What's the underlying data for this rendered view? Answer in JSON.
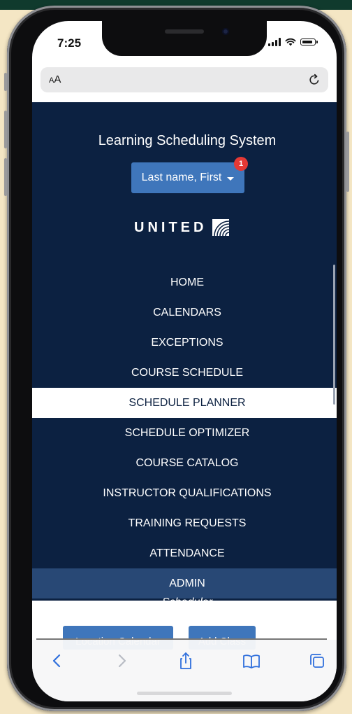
{
  "status_bar": {
    "time": "7:25"
  },
  "address_bar": {
    "text_size_label_small": "A",
    "text_size_label_large": "A"
  },
  "header": {
    "app_title": "Learning Scheduling System",
    "user_button_label": "Last name, First",
    "notification_count": "1",
    "logo_text": "UNITED"
  },
  "menu": {
    "items": [
      {
        "label": "HOME"
      },
      {
        "label": "CALENDARS"
      },
      {
        "label": "EXCEPTIONS"
      },
      {
        "label": "COURSE SCHEDULE"
      },
      {
        "label": "SCHEDULE PLANNER",
        "active": true
      },
      {
        "label": "SCHEDULE OPTIMIZER"
      },
      {
        "label": "COURSE CATALOG"
      },
      {
        "label": "INSTRUCTOR QUALIFICATIONS"
      },
      {
        "label": "TRAINING REQUESTS"
      },
      {
        "label": "ATTENDANCE"
      },
      {
        "label": "ADMIN"
      }
    ],
    "role_label": "Scheduler"
  },
  "page_buttons": {
    "location_calendar": "Location Calendar",
    "add_class": "Add Class"
  },
  "toolbar": {
    "icons": [
      "back-icon",
      "forward-icon",
      "share-icon",
      "bookmarks-icon",
      "tabs-icon"
    ]
  },
  "colors": {
    "nav_bg": "#0c2141",
    "accent_blue": "#3f76bb",
    "admin_bg": "#284875",
    "badge_red": "#e53935"
  }
}
